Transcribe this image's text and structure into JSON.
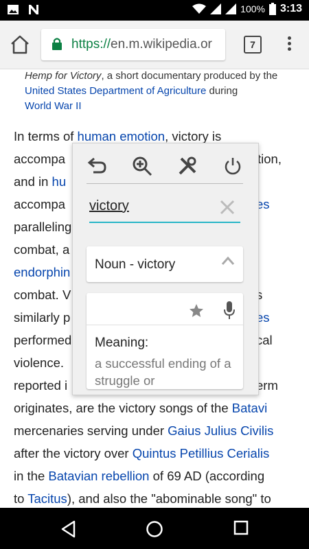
{
  "status_bar": {
    "battery": "100%",
    "time": "3:13",
    "icons": [
      "image-icon",
      "n-icon",
      "wifi-icon",
      "signal-icon",
      "signal-icon",
      "battery-icon"
    ]
  },
  "browser": {
    "url_scheme": "https://",
    "url_host": "en.m.wikipedia.or",
    "tab_count": "7"
  },
  "caption": {
    "italic_title": "Hemp for Victory",
    "text_1": ", a short documentary produced by the ",
    "link_usda": "United States Department of Agriculture",
    "text_2": " during",
    "link_ww2": "World War II"
  },
  "article": {
    "l1_a": "In terms of ",
    "l1_link": "human emotion",
    "l1_b": ", victory is",
    "l2_a": "accompa",
    "l2_b": "tion,",
    "l3_a": "and in ",
    "l3_link": "hu",
    "l4_a": "accompa",
    "l4_link": "es",
    "l5_a": "paralleling",
    "l6_a": "combat, a",
    "l7_link": "endorphin",
    "l8_a": "combat. V",
    "l8_b": "s",
    "l9_a": "similarly p",
    "l9_link": "es",
    "l10_a": "performed",
    "l10_b": "cal",
    "l11_a": "violence.",
    "l12_a": "reported i",
    "l12_b": "erm",
    "l13_a": "originates, are the victory songs of the ",
    "l13_link": "Batavi",
    "l14_a": "mercenaries serving under ",
    "l14_link": "Gaius Julius Civilis",
    "l15_a": "after the victory over ",
    "l15_link": "Quintus Petillius Cerialis",
    "l16_a": "in the ",
    "l16_link": "Batavian rebellion",
    "l16_b": " of 69 AD (according",
    "l17_a": "to ",
    "l17_link": "Tacitus",
    "l17_b": "), and also the \"abominable song\" to"
  },
  "dictionary_popup": {
    "search_word": "victory",
    "part_of_speech": "Noun - victory",
    "meaning_heading": "Meaning:",
    "meaning_text": "a successful ending of a struggle or"
  },
  "colors": {
    "link": "#0645ad",
    "secure_green": "#0b8043",
    "input_underline": "#26b5c6"
  }
}
